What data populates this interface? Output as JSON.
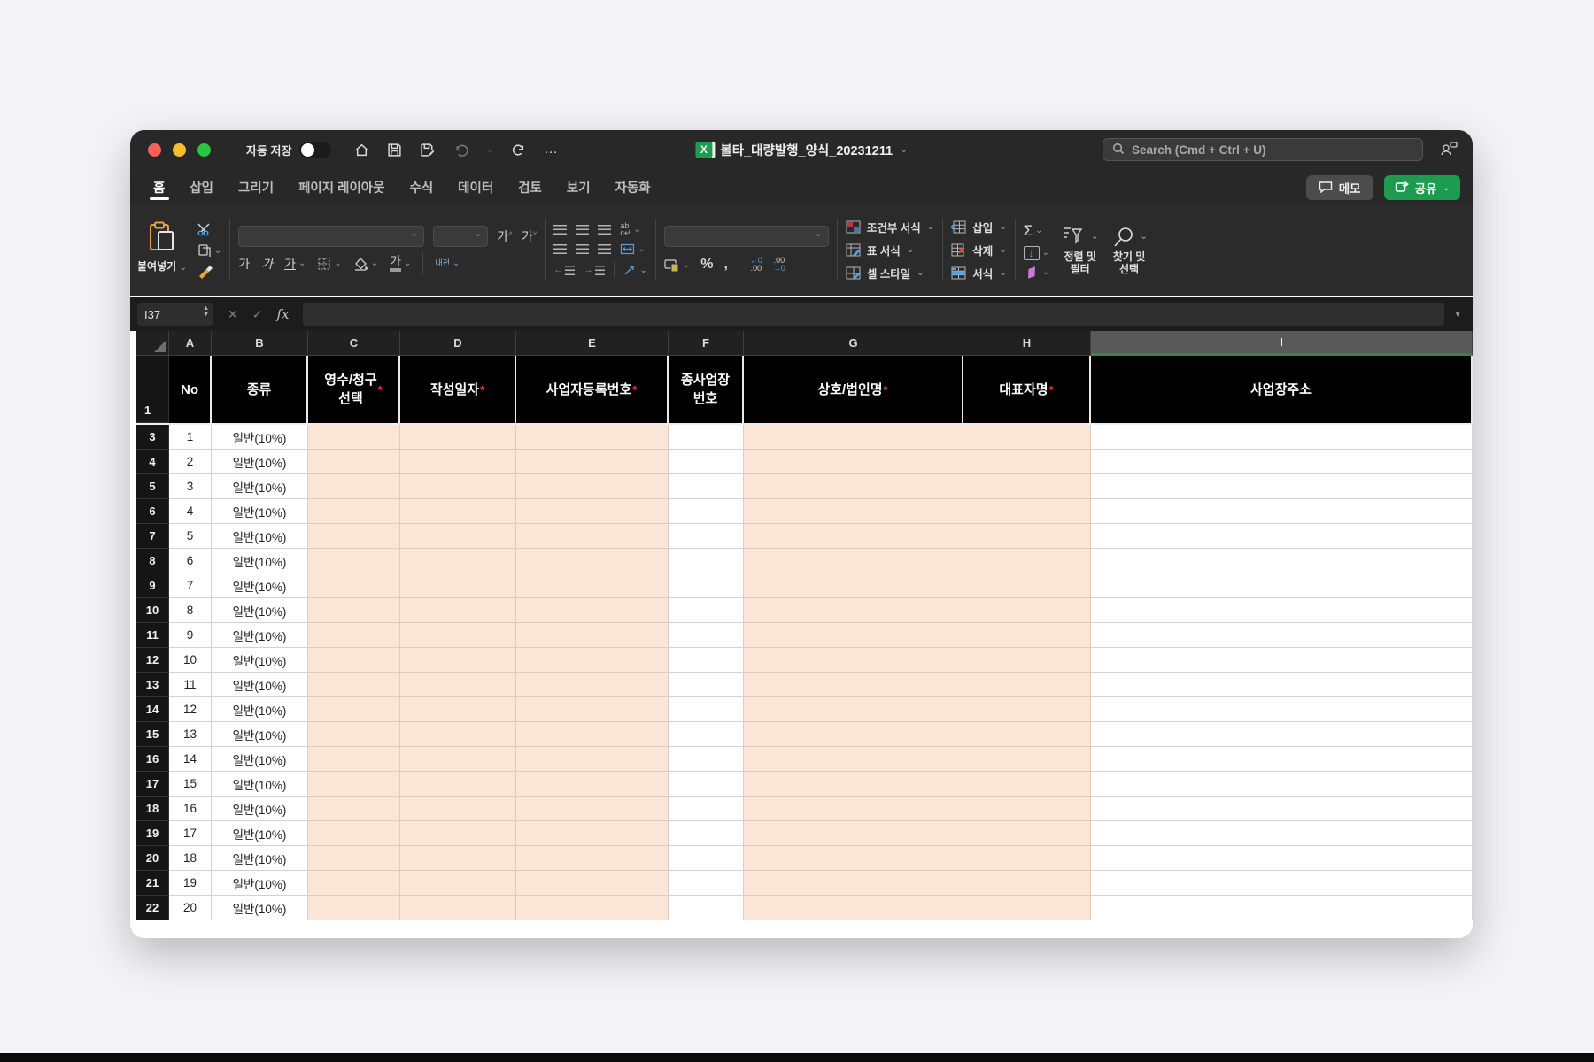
{
  "window": {
    "titlebar": {
      "autosave_label": "자동 저장",
      "autosave_on": false,
      "title": "볼타_대량발행_양식_20231211",
      "search_placeholder": "Search (Cmd + Ctrl + U)"
    },
    "tabs": [
      {
        "label": "홈",
        "active": true
      },
      {
        "label": "삽입",
        "active": false
      },
      {
        "label": "그리기",
        "active": false
      },
      {
        "label": "페이지 레이아웃",
        "active": false
      },
      {
        "label": "수식",
        "active": false
      },
      {
        "label": "데이터",
        "active": false
      },
      {
        "label": "검토",
        "active": false
      },
      {
        "label": "보기",
        "active": false
      },
      {
        "label": "자동화",
        "active": false
      }
    ],
    "actions": {
      "memo": "메모",
      "share": "공유"
    },
    "ribbon": {
      "paste_label": "붙여넣기",
      "font_glyph": "가",
      "orientation_glyph": "내천",
      "percent": "%",
      "comma": ",",
      "sigma": "Σ",
      "fill_down": "↓",
      "dec_left": "←0\n.00",
      "dec_right": ".00\n→0",
      "styles": [
        {
          "label": "조건부 서식"
        },
        {
          "label": "표 서식"
        },
        {
          "label": "셀 스타일"
        }
      ],
      "cells": [
        {
          "label": "삽입"
        },
        {
          "label": "삭제"
        },
        {
          "label": "서식"
        }
      ],
      "sort_filter": "정렬 및\n필터",
      "find_select": "찾기 및\n선택"
    },
    "formula_bar": {
      "cell_ref": "I37",
      "fx_label": "fx"
    },
    "grid": {
      "selected_column": "I",
      "column_letters": [
        "A",
        "B",
        "C",
        "D",
        "E",
        "F",
        "G",
        "H",
        "I"
      ],
      "header_row_number": "1",
      "header_row": [
        {
          "col": "A",
          "text": "No",
          "required": false
        },
        {
          "col": "B",
          "text": "종류",
          "required": false
        },
        {
          "col": "C",
          "text": "영수/청구\n선택",
          "required": true
        },
        {
          "col": "D",
          "text": "작성일자",
          "required": true
        },
        {
          "col": "E",
          "text": "사업자등록번호",
          "required": true
        },
        {
          "col": "F",
          "text": "종사업장\n번호",
          "required": false
        },
        {
          "col": "G",
          "text": "상호/법인명",
          "required": true
        },
        {
          "col": "H",
          "text": "대표자명",
          "required": true
        },
        {
          "col": "I",
          "text": "사업장주소",
          "required": false
        }
      ],
      "peach_columns": [
        "C",
        "D",
        "E",
        "G",
        "H"
      ],
      "rows": [
        {
          "row": 3,
          "no": "1",
          "type": "일반(10%)"
        },
        {
          "row": 4,
          "no": "2",
          "type": "일반(10%)"
        },
        {
          "row": 5,
          "no": "3",
          "type": "일반(10%)"
        },
        {
          "row": 6,
          "no": "4",
          "type": "일반(10%)"
        },
        {
          "row": 7,
          "no": "5",
          "type": "일반(10%)"
        },
        {
          "row": 8,
          "no": "6",
          "type": "일반(10%)"
        },
        {
          "row": 9,
          "no": "7",
          "type": "일반(10%)"
        },
        {
          "row": 10,
          "no": "8",
          "type": "일반(10%)"
        },
        {
          "row": 11,
          "no": "9",
          "type": "일반(10%)"
        },
        {
          "row": 12,
          "no": "10",
          "type": "일반(10%)"
        },
        {
          "row": 13,
          "no": "11",
          "type": "일반(10%)"
        },
        {
          "row": 14,
          "no": "12",
          "type": "일반(10%)"
        },
        {
          "row": 15,
          "no": "13",
          "type": "일반(10%)"
        },
        {
          "row": 16,
          "no": "14",
          "type": "일반(10%)"
        },
        {
          "row": 17,
          "no": "15",
          "type": "일반(10%)"
        },
        {
          "row": 18,
          "no": "16",
          "type": "일반(10%)"
        },
        {
          "row": 19,
          "no": "17",
          "type": "일반(10%)"
        },
        {
          "row": 20,
          "no": "18",
          "type": "일반(10%)"
        },
        {
          "row": 21,
          "no": "19",
          "type": "일반(10%)"
        },
        {
          "row": 22,
          "no": "20",
          "type": "일반(10%)"
        }
      ]
    },
    "colors": {
      "share_green": "#1d9b4e",
      "selection_green": "#2f8a50",
      "required_red": "#ff2e2e",
      "input_peach": "#fbe5d6"
    }
  }
}
